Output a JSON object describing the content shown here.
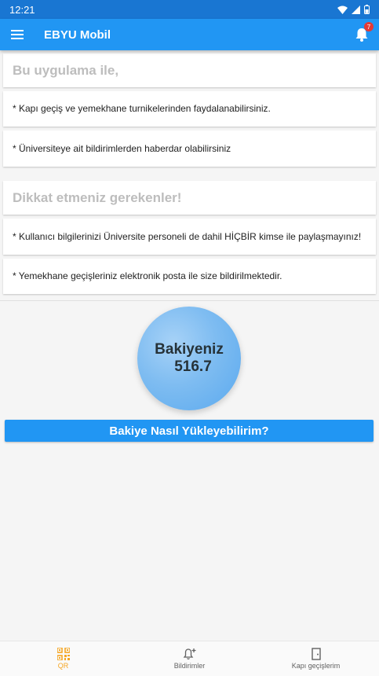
{
  "status_bar": {
    "time": "12:21"
  },
  "app_bar": {
    "title": "EBYU Mobil",
    "notification_count": "7"
  },
  "info_cards": [
    {
      "text": "Bu uygulama ile,"
    },
    {
      "text": "* Kapı geçiş ve yemekhane turnikelerinden faydalanabilirsiniz."
    },
    {
      "text": "* Üniversiteye ait bildirimlerden haberdar olabilirsiniz"
    },
    {
      "text": "Dikkat etmeniz gerekenler!"
    },
    {
      "text": " * Kullanıcı bilgilerinizi Üniversite personeli de dahil HİÇBİR kimse ile paylaşmayınız!"
    },
    {
      "text": "* Yemekhane geçişleriniz elektronik posta ile size bildirilmektedir."
    }
  ],
  "balance": {
    "label": "Bakiyeniz",
    "value": "516.7"
  },
  "topup_button": {
    "label": "Bakiye Nasıl Yükleyebilirim?"
  },
  "bottom_nav": {
    "items": [
      {
        "label": "QR",
        "icon": "qr-code-icon",
        "active": true
      },
      {
        "label": "Bildirimler",
        "icon": "bell-plus-icon",
        "active": false
      },
      {
        "label": "Kapı geçişlerim",
        "icon": "door-icon",
        "active": false
      }
    ]
  },
  "colors": {
    "primary": "#2196f3",
    "status_bar": "#1976d2",
    "active_nav": "#f5a623",
    "badge": "#e53935"
  }
}
